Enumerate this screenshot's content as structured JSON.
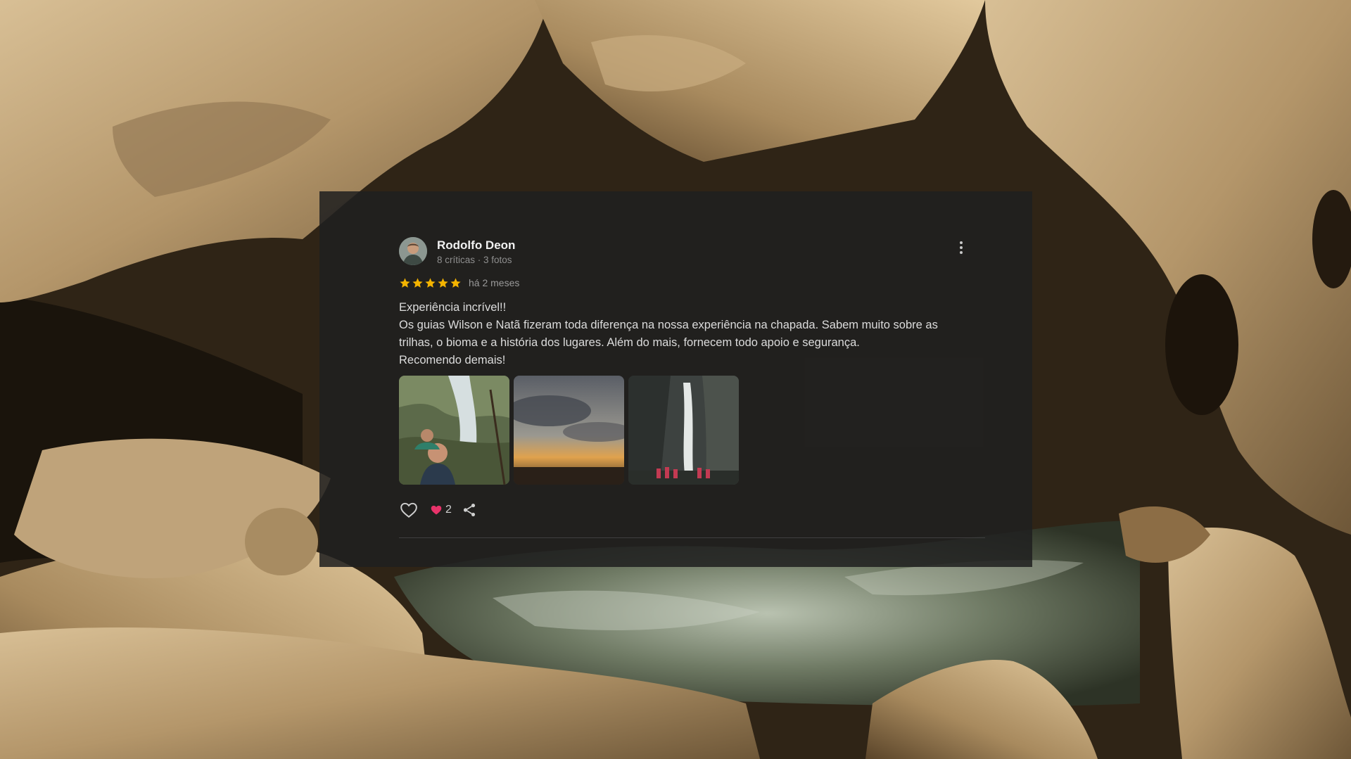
{
  "review": {
    "reviewer": {
      "name": "Rodolfo Deon",
      "meta": "8 críticas · 3 fotos"
    },
    "rating": 5,
    "date": "há 2 meses",
    "text": {
      "title": "Experiência incrível!!",
      "body": "Os guias Wilson e Natã fizeram toda diferença na nossa experiência na chapada. Sabem muito sobre as trilhas, o bioma e a história dos lugares. Além do mais, fornecem todo apoio e segurança.",
      "closing": "Recomendo demais!"
    },
    "likes": {
      "count": "2"
    }
  },
  "colors": {
    "star": "#f4b400",
    "heart": "#e8336a",
    "card_background": "#202020"
  },
  "icons": {
    "like": "heart-outline-icon",
    "liked": "heart-filled-icon",
    "share": "share-icon",
    "more": "more-vertical-icon"
  }
}
